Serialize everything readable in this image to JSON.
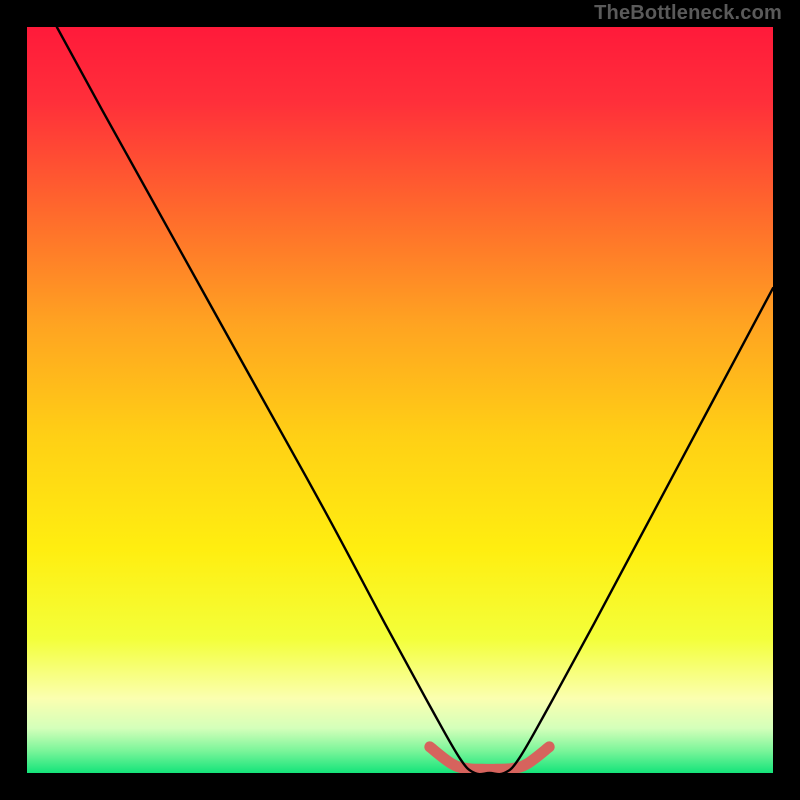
{
  "attribution": "TheBottleneck.com",
  "chart_data": {
    "type": "line",
    "title": "",
    "xlabel": "",
    "ylabel": "",
    "xlim": [
      0,
      100
    ],
    "ylim": [
      0,
      100
    ],
    "series": [
      {
        "name": "bottleneck-curve",
        "x": [
          4,
          10,
          20,
          30,
          40,
          48,
          54,
          58,
          60,
          62,
          64,
          66,
          70,
          76,
          84,
          92,
          100
        ],
        "values": [
          100,
          89,
          71,
          53,
          35,
          20,
          9,
          2,
          0,
          0,
          0,
          2,
          9,
          20,
          35,
          50,
          65
        ]
      },
      {
        "name": "bottom-tolerance-band",
        "x": [
          54,
          57,
          59,
          61,
          63,
          65,
          67,
          70
        ],
        "values": [
          3.5,
          1.2,
          0.6,
          0.5,
          0.5,
          0.6,
          1.2,
          3.5
        ]
      }
    ],
    "gradient_stops": [
      {
        "offset": 0.0,
        "color": "#ff1a3a"
      },
      {
        "offset": 0.1,
        "color": "#ff2f3a"
      },
      {
        "offset": 0.25,
        "color": "#ff6a2c"
      },
      {
        "offset": 0.4,
        "color": "#ffa421"
      },
      {
        "offset": 0.55,
        "color": "#ffd015"
      },
      {
        "offset": 0.7,
        "color": "#ffee10"
      },
      {
        "offset": 0.82,
        "color": "#f3ff3a"
      },
      {
        "offset": 0.9,
        "color": "#fbffb0"
      },
      {
        "offset": 0.94,
        "color": "#d4ffba"
      },
      {
        "offset": 0.97,
        "color": "#7cf59a"
      },
      {
        "offset": 1.0,
        "color": "#14e47a"
      }
    ],
    "colors": {
      "curve": "#000000",
      "band": "#d6635d"
    }
  }
}
